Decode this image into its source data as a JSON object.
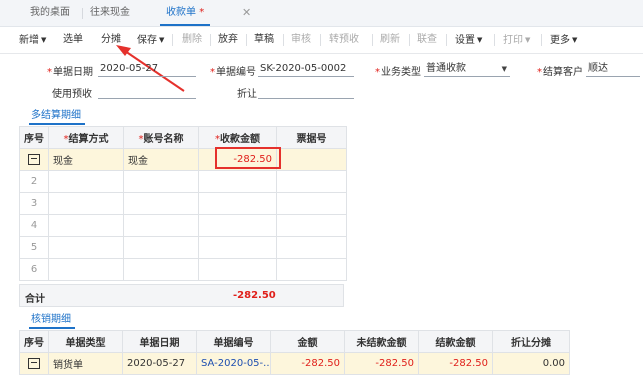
{
  "tabs": [
    {
      "label": "我的桌面"
    },
    {
      "label": "往来现金"
    },
    {
      "label": "收款单",
      "modified": "*",
      "close": "✕"
    }
  ],
  "toolbar": {
    "new": "新增",
    "select_doc": "选单",
    "split": "分摊",
    "save": "保存",
    "delete": "删除",
    "abandon": "放弃",
    "draft": "草稿",
    "audit": "审核",
    "to_prepay": "转预收",
    "refresh": "刷新",
    "link_query": "联查",
    "settings": "设置",
    "print": "打印",
    "more": "更多"
  },
  "form": {
    "doc_date": {
      "label": "单据日期",
      "value": "2020-05-27"
    },
    "doc_no": {
      "label": "单据编号",
      "value": "SK-2020-05-0002"
    },
    "biz_type": {
      "label": "业务类型",
      "value": "普通收款"
    },
    "customer": {
      "label": "结算客户",
      "value": "顺达"
    },
    "use_prepay": {
      "label": "使用预收",
      "value": ""
    },
    "discount": {
      "label": "折让",
      "value": ""
    }
  },
  "settlement": {
    "title": "多结算期细",
    "headers": [
      "序号",
      "结算方式",
      "账号名称",
      "收款金额",
      "票据号"
    ],
    "rows": [
      {
        "idx": "",
        "method": "现金",
        "account": "现金",
        "amount": "-282.50",
        "bill": ""
      },
      {
        "idx": "2"
      },
      {
        "idx": "3"
      },
      {
        "idx": "4"
      },
      {
        "idx": "5"
      },
      {
        "idx": "6"
      }
    ],
    "total_label": "合计",
    "total_value": "-282.50"
  },
  "writeoff": {
    "title": "核销期细",
    "headers": [
      "序号",
      "单据类型",
      "单据日期",
      "单据编号",
      "金额",
      "未结款金额",
      "结款金额",
      "折让分摊"
    ],
    "rows": [
      {
        "type": "销货单",
        "date": "2020-05-27",
        "no": "SA-2020-05-...",
        "amount": "-282.50",
        "unpaid": "-282.50",
        "paid": "-282.50",
        "discount": "0.00"
      }
    ]
  },
  "colors": {
    "accent": "#1e72c8",
    "required": "#e0201b",
    "highlight": "#e5312c",
    "selected_row": "#fdf6dc"
  }
}
